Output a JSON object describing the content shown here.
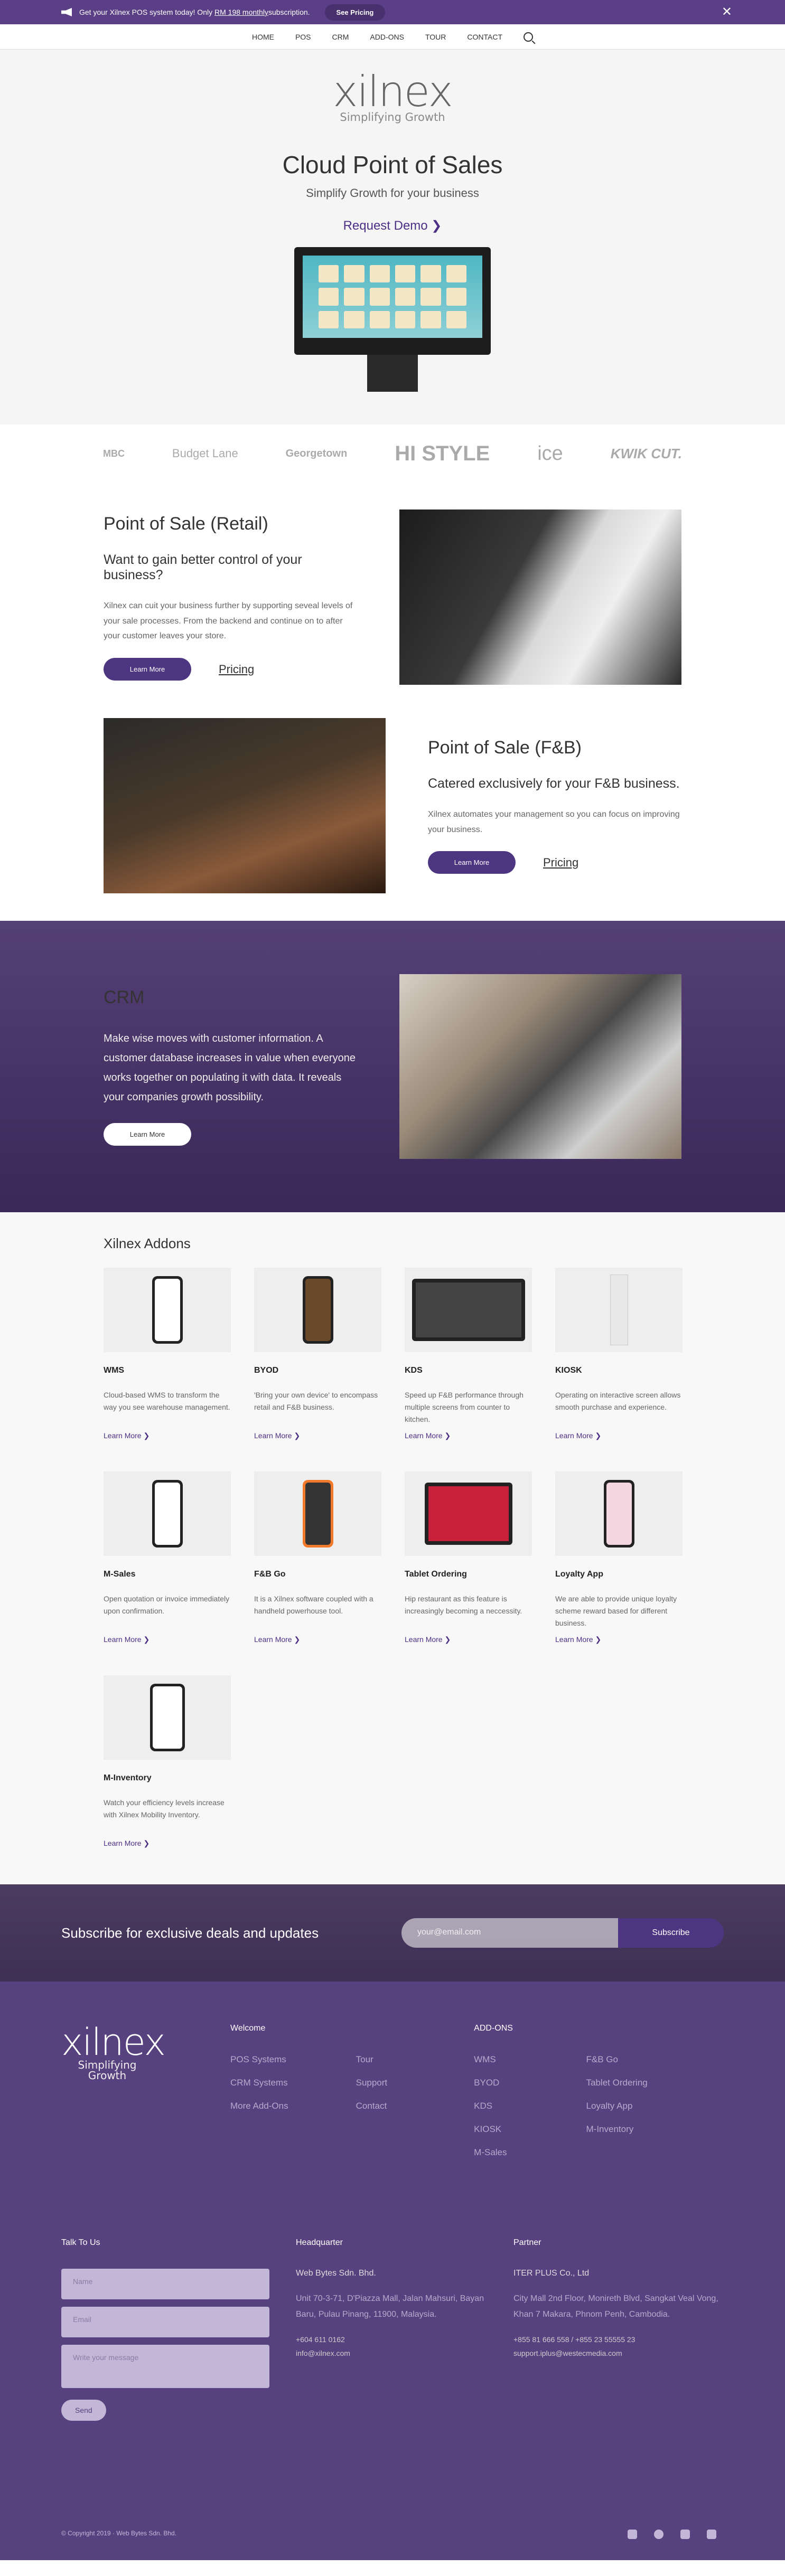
{
  "promo": {
    "text_before": "Get your Xilnex POS system today! Only ",
    "link": "RM 198 monthly",
    "text_after": " subscription.",
    "button": "See Pricing",
    "close": "✕"
  },
  "nav": {
    "items": [
      "HOME",
      "POS",
      "CRM",
      "ADD-ONS",
      "TOUR",
      "CONTACT"
    ]
  },
  "logo": {
    "word": "xilnex",
    "tagline": "Simplifying Growth"
  },
  "hero": {
    "title": "Cloud Point of Sales",
    "subtitle": "Simplify Growth for your business",
    "demo": "Request Demo ❯"
  },
  "brands": [
    "MBC",
    "Budget Lane",
    "Georgetown",
    "HI STYLE",
    "ice",
    "KWIK CUT."
  ],
  "retail": {
    "title": "Point of Sale (Retail)",
    "heading": "Want to gain better control of your business?",
    "body": "Xilnex can cuit your business further by supporting seveal levels of your sale processes. From the backend and continue on to after your customer leaves your store.",
    "btn": "Learn More",
    "pricing": "Pricing"
  },
  "fnb": {
    "title": "Point of Sale (F&B)",
    "heading": "Catered exclusively for your F&B business.",
    "body": "Xilnex automates your management so you can focus on improving your business.",
    "btn": "Learn More",
    "pricing": "Pricing"
  },
  "crm": {
    "title": "CRM",
    "body": "Make wise moves with customer information. A customer database increases in value when everyone works together on populating it with data. It reveals your companies growth possibility.",
    "btn": "Learn More"
  },
  "addons": {
    "title": "Xilnex Addons",
    "items": [
      {
        "name": "WMS",
        "desc": "Cloud-based WMS to transform the way you see warehouse management.",
        "more": "Learn More ❯"
      },
      {
        "name": "BYOD",
        "desc": "'Bring your own device' to encompass retail and F&B business.",
        "more": "Learn More ❯"
      },
      {
        "name": "KDS",
        "desc": "Speed up F&B performance through multiple screens from counter to kitchen.",
        "more": "Learn More ❯"
      },
      {
        "name": "KIOSK",
        "desc": "Operating on interactive screen allows smooth purchase and experience.",
        "more": "Learn More ❯"
      },
      {
        "name": "M-Sales",
        "desc": "Open quotation or invoice immediately upon confirmation.",
        "more": "Learn More ❯"
      },
      {
        "name": "F&B Go",
        "desc": "It is a Xilnex software coupled with a handheld powerhouse tool.",
        "more": "Learn More ❯"
      },
      {
        "name": "Tablet Ordering",
        "desc": "Hip restaurant as this feature is increasingly becoming a neccessity.",
        "more": "Learn More ❯"
      },
      {
        "name": "Loyalty App",
        "desc": "We are able to provide unique loyalty scheme reward based for different business.",
        "more": "Learn More ❯"
      },
      {
        "name": "M-Inventory",
        "desc": "Watch your efficiency levels increase with Xilnex Mobility Inventory.",
        "more": "Learn More ❯"
      }
    ]
  },
  "subscribe": {
    "title": "Subscribe for exclusive deals and updates",
    "placeholder": "your@email.com",
    "button": "Subscribe"
  },
  "footer": {
    "welcome": {
      "title": "Welcome",
      "items": [
        "POS Systems",
        "CRM Systems",
        "More Add-Ons",
        "Tour",
        "Support",
        "Contact"
      ]
    },
    "addons": {
      "title": "ADD-ONS",
      "items": [
        "WMS",
        "BYOD",
        "KDS",
        "KIOSK",
        "M-Sales",
        "F&B Go",
        "Tablet Ordering",
        "Loyalty App",
        "M-Inventory"
      ]
    },
    "talk": {
      "title": "Talk To Us",
      "name": "Name",
      "email": "Email",
      "message": "Write your message",
      "send": "Send"
    },
    "hq": {
      "title": "Headquarter",
      "name": "Web Bytes Sdn. Bhd.",
      "address": "Unit 70-3-71, D'Piazza Mall, Jalan Mahsuri, Bayan Baru, Pulau Pinang, 11900, Malaysia.",
      "phone": "+604 611 0162",
      "email": "info@xilnex.com"
    },
    "partner": {
      "title": "Partner",
      "name": "ITER PLUS Co., Ltd",
      "address": "City Mall 2nd Floor, Monireth Blvd, Sangkat Veal Vong, Khan 7 Makara, Phnom Penh, Cambodia.",
      "phone": "+855 81 666 558  /  +855 23 55555 23",
      "email": "support.iplus@westecmedia.com"
    },
    "copyright": "© Copyright 2019 · Web Bytes Sdn. Bhd."
  }
}
